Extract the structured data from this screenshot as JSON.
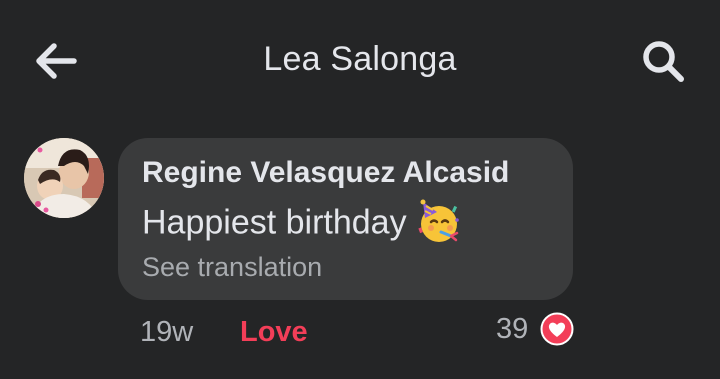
{
  "header": {
    "title": "Lea Salonga",
    "back_icon": "arrow-left-icon",
    "search_icon": "search-icon"
  },
  "comment": {
    "author": "Regine Velasquez Alcasid",
    "text": "Happiest birthday",
    "emoji": "partying-face-icon",
    "see_translation": "See translation",
    "time": "19w",
    "reaction_label": "Love",
    "reaction_count": "39",
    "reaction_icon": "heart-reaction-icon"
  },
  "colors": {
    "background": "#242526",
    "bubble": "#3a3b3c",
    "primary_text": "#e4e6eb",
    "secondary_text": "#b0b3b8",
    "love_accent": "#f33e58"
  }
}
